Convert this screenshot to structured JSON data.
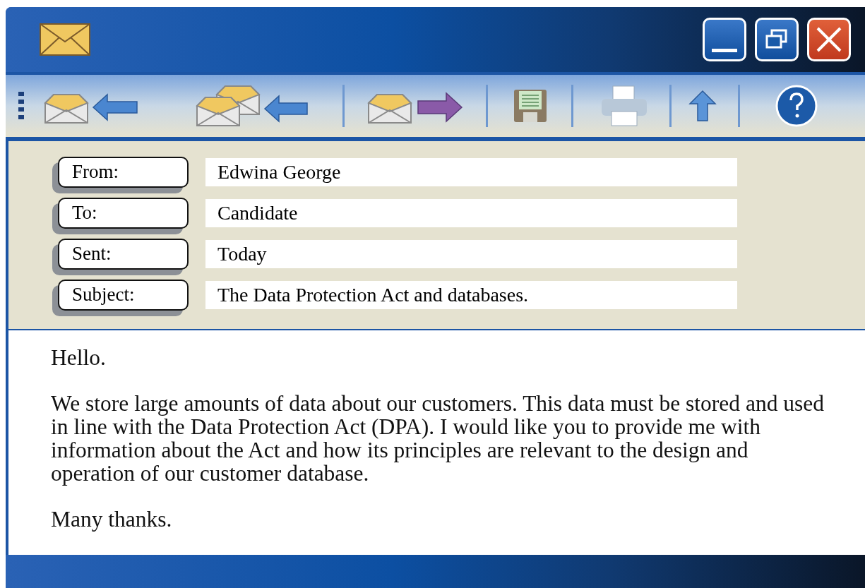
{
  "header_fields": [
    {
      "label": "From:",
      "value": "Edwina George"
    },
    {
      "label": "To:",
      "value": "Candidate"
    },
    {
      "label": "Sent:",
      "value": "Today"
    },
    {
      "label": "Subject:",
      "value": "The Data Protection Act and databases."
    }
  ],
  "message_body": [
    "Hello.",
    "We store large amounts of data about our customers. This data must be stored and used in line with the Data Protection Act (DPA). I would like you to provide me with information about the Act and how its principles are relevant to the design and operation of our customer database.",
    "Many thanks."
  ]
}
